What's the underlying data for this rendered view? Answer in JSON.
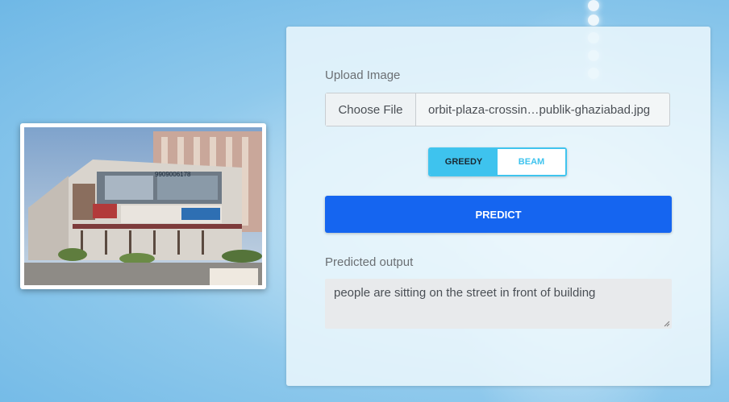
{
  "upload": {
    "label": "Upload Image",
    "choose_file": "Choose File",
    "file_name": "orbit-plaza-crossin…publik-ghaziabad.jpg"
  },
  "decoding": {
    "options": [
      "GREEDY",
      "BEAM"
    ],
    "selected": "GREEDY"
  },
  "predict_button": "PREDICT",
  "output": {
    "label": "Predicted output",
    "text": "people are sitting on the street in front of building"
  },
  "colors": {
    "accent": "#1565f0",
    "toggle": "#3ec3ee"
  },
  "photo": {
    "billboard_number": "9909006178"
  }
}
